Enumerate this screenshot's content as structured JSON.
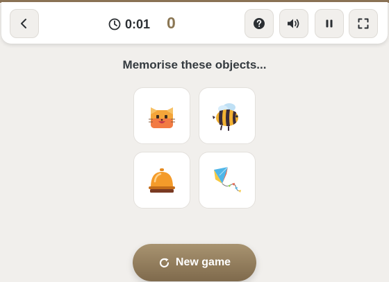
{
  "toolbar": {
    "timer": "0:01",
    "score": "0",
    "icons": {
      "back": "chevron-left-icon",
      "timer": "clock-icon",
      "help": "question-icon",
      "sound": "speaker-icon",
      "pause": "pause-icon",
      "fullscreen": "fullscreen-icon"
    }
  },
  "game": {
    "instruction": "Memorise these objects...",
    "objects": [
      "cat",
      "bee",
      "service-bell",
      "kite"
    ]
  },
  "actions": {
    "new_game_label": "New game",
    "new_game_icon": "restart-icon"
  },
  "colors": {
    "accent": "#8a7653",
    "background": "#f1efec",
    "button_gradient_top": "#a89370",
    "button_gradient_bottom": "#7f6a4c"
  }
}
